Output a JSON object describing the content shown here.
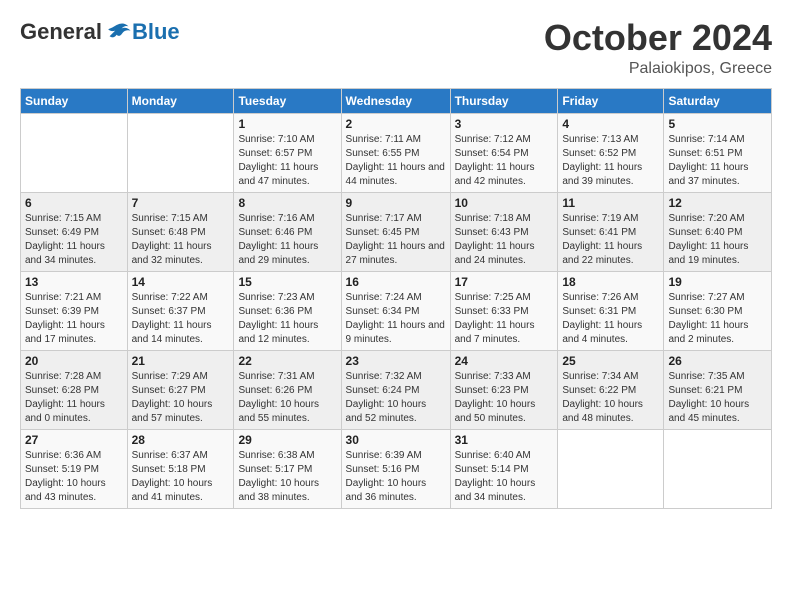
{
  "header": {
    "logo": {
      "general": "General",
      "blue": "Blue"
    },
    "month": "October 2024",
    "location": "Palaiokipos, Greece"
  },
  "weekdays": [
    "Sunday",
    "Monday",
    "Tuesday",
    "Wednesday",
    "Thursday",
    "Friday",
    "Saturday"
  ],
  "weeks": [
    [
      {
        "day": "",
        "info": ""
      },
      {
        "day": "",
        "info": ""
      },
      {
        "day": "1",
        "info": "Sunrise: 7:10 AM\nSunset: 6:57 PM\nDaylight: 11 hours and 47 minutes."
      },
      {
        "day": "2",
        "info": "Sunrise: 7:11 AM\nSunset: 6:55 PM\nDaylight: 11 hours and 44 minutes."
      },
      {
        "day": "3",
        "info": "Sunrise: 7:12 AM\nSunset: 6:54 PM\nDaylight: 11 hours and 42 minutes."
      },
      {
        "day": "4",
        "info": "Sunrise: 7:13 AM\nSunset: 6:52 PM\nDaylight: 11 hours and 39 minutes."
      },
      {
        "day": "5",
        "info": "Sunrise: 7:14 AM\nSunset: 6:51 PM\nDaylight: 11 hours and 37 minutes."
      }
    ],
    [
      {
        "day": "6",
        "info": "Sunrise: 7:15 AM\nSunset: 6:49 PM\nDaylight: 11 hours and 34 minutes."
      },
      {
        "day": "7",
        "info": "Sunrise: 7:15 AM\nSunset: 6:48 PM\nDaylight: 11 hours and 32 minutes."
      },
      {
        "day": "8",
        "info": "Sunrise: 7:16 AM\nSunset: 6:46 PM\nDaylight: 11 hours and 29 minutes."
      },
      {
        "day": "9",
        "info": "Sunrise: 7:17 AM\nSunset: 6:45 PM\nDaylight: 11 hours and 27 minutes."
      },
      {
        "day": "10",
        "info": "Sunrise: 7:18 AM\nSunset: 6:43 PM\nDaylight: 11 hours and 24 minutes."
      },
      {
        "day": "11",
        "info": "Sunrise: 7:19 AM\nSunset: 6:41 PM\nDaylight: 11 hours and 22 minutes."
      },
      {
        "day": "12",
        "info": "Sunrise: 7:20 AM\nSunset: 6:40 PM\nDaylight: 11 hours and 19 minutes."
      }
    ],
    [
      {
        "day": "13",
        "info": "Sunrise: 7:21 AM\nSunset: 6:39 PM\nDaylight: 11 hours and 17 minutes."
      },
      {
        "day": "14",
        "info": "Sunrise: 7:22 AM\nSunset: 6:37 PM\nDaylight: 11 hours and 14 minutes."
      },
      {
        "day": "15",
        "info": "Sunrise: 7:23 AM\nSunset: 6:36 PM\nDaylight: 11 hours and 12 minutes."
      },
      {
        "day": "16",
        "info": "Sunrise: 7:24 AM\nSunset: 6:34 PM\nDaylight: 11 hours and 9 minutes."
      },
      {
        "day": "17",
        "info": "Sunrise: 7:25 AM\nSunset: 6:33 PM\nDaylight: 11 hours and 7 minutes."
      },
      {
        "day": "18",
        "info": "Sunrise: 7:26 AM\nSunset: 6:31 PM\nDaylight: 11 hours and 4 minutes."
      },
      {
        "day": "19",
        "info": "Sunrise: 7:27 AM\nSunset: 6:30 PM\nDaylight: 11 hours and 2 minutes."
      }
    ],
    [
      {
        "day": "20",
        "info": "Sunrise: 7:28 AM\nSunset: 6:28 PM\nDaylight: 11 hours and 0 minutes."
      },
      {
        "day": "21",
        "info": "Sunrise: 7:29 AM\nSunset: 6:27 PM\nDaylight: 10 hours and 57 minutes."
      },
      {
        "day": "22",
        "info": "Sunrise: 7:31 AM\nSunset: 6:26 PM\nDaylight: 10 hours and 55 minutes."
      },
      {
        "day": "23",
        "info": "Sunrise: 7:32 AM\nSunset: 6:24 PM\nDaylight: 10 hours and 52 minutes."
      },
      {
        "day": "24",
        "info": "Sunrise: 7:33 AM\nSunset: 6:23 PM\nDaylight: 10 hours and 50 minutes."
      },
      {
        "day": "25",
        "info": "Sunrise: 7:34 AM\nSunset: 6:22 PM\nDaylight: 10 hours and 48 minutes."
      },
      {
        "day": "26",
        "info": "Sunrise: 7:35 AM\nSunset: 6:21 PM\nDaylight: 10 hours and 45 minutes."
      }
    ],
    [
      {
        "day": "27",
        "info": "Sunrise: 6:36 AM\nSunset: 5:19 PM\nDaylight: 10 hours and 43 minutes."
      },
      {
        "day": "28",
        "info": "Sunrise: 6:37 AM\nSunset: 5:18 PM\nDaylight: 10 hours and 41 minutes."
      },
      {
        "day": "29",
        "info": "Sunrise: 6:38 AM\nSunset: 5:17 PM\nDaylight: 10 hours and 38 minutes."
      },
      {
        "day": "30",
        "info": "Sunrise: 6:39 AM\nSunset: 5:16 PM\nDaylight: 10 hours and 36 minutes."
      },
      {
        "day": "31",
        "info": "Sunrise: 6:40 AM\nSunset: 5:14 PM\nDaylight: 10 hours and 34 minutes."
      },
      {
        "day": "",
        "info": ""
      },
      {
        "day": "",
        "info": ""
      }
    ]
  ]
}
